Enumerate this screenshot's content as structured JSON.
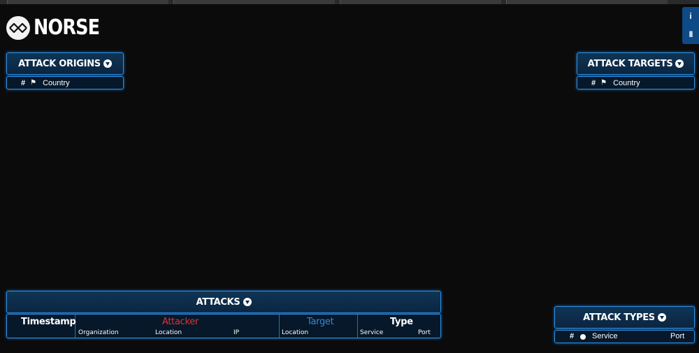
{
  "brand": {
    "name": "NORSE"
  },
  "controls": {
    "info_label": "i",
    "pause_label": "II"
  },
  "origins": {
    "title": "ATTACK ORIGINS",
    "col_hash": "#",
    "col_country": "Country"
  },
  "targets": {
    "title": "ATTACK TARGETS",
    "col_hash": "#",
    "col_country": "Country"
  },
  "attacks": {
    "title": "ATTACKS",
    "headers": {
      "timestamp": "Timestamp",
      "attacker": "Attacker",
      "target": "Target",
      "type": "Type"
    },
    "sub": {
      "organization": "Organization",
      "attacker_location": "Location",
      "ip": "IP",
      "target_location": "Location",
      "service": "Service",
      "port": "Port"
    },
    "colors": {
      "attacker": "#e0322e",
      "target": "#3a86d6"
    }
  },
  "types": {
    "title": "ATTACK TYPES",
    "col_hash": "#",
    "col_service": "Service",
    "col_port": "Port"
  }
}
